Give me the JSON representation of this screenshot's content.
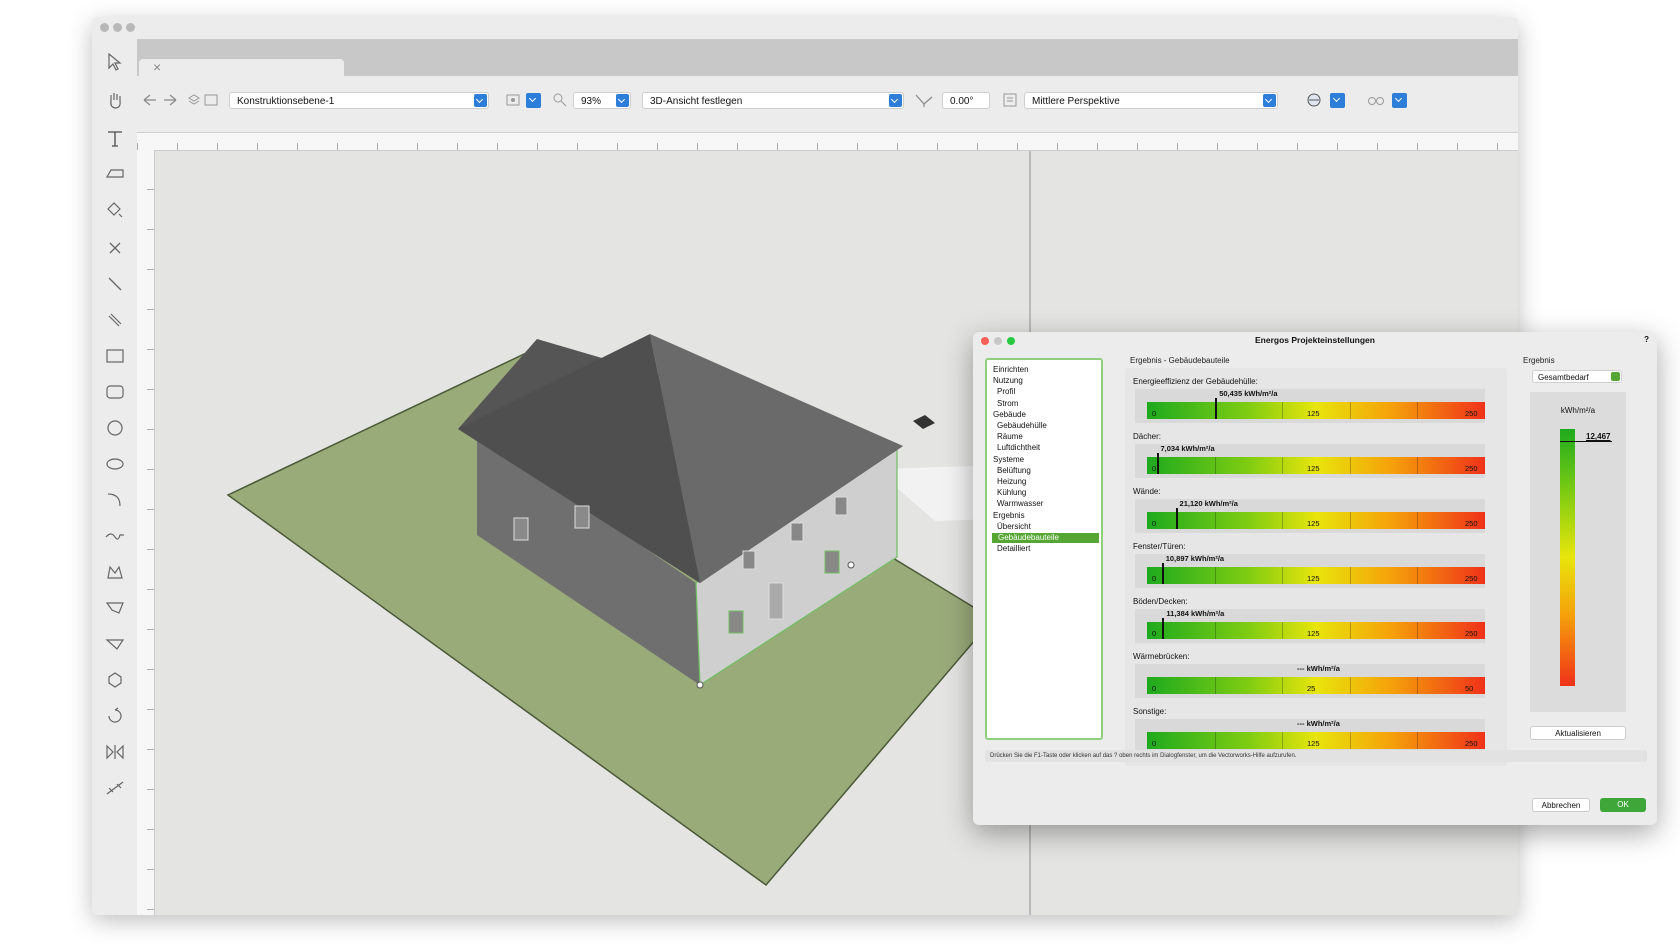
{
  "toolbar": {
    "layer_combo": "Konstruktionsebene-1",
    "zoom": "93%",
    "view_combo": "3D-Ansicht festlegen",
    "angle": "0.00°",
    "perspective_combo": "Mittlere Perspektive"
  },
  "dialog": {
    "title": "Energos Projekteinstellungen",
    "help": "?",
    "nav": [
      {
        "label": "Einrichten",
        "level": 0
      },
      {
        "label": "Nutzung",
        "level": 0
      },
      {
        "label": "Profil",
        "level": 1
      },
      {
        "label": "Strom",
        "level": 1
      },
      {
        "label": "Gebäude",
        "level": 0
      },
      {
        "label": "Gebäudehülle",
        "level": 1
      },
      {
        "label": "Räume",
        "level": 1
      },
      {
        "label": "Luftdichtheit",
        "level": 1
      },
      {
        "label": "Systeme",
        "level": 0
      },
      {
        "label": "Belüftung",
        "level": 1
      },
      {
        "label": "Heizung",
        "level": 1
      },
      {
        "label": "Kühlung",
        "level": 1
      },
      {
        "label": "Warmwasser",
        "level": 1
      },
      {
        "label": "Ergebnis",
        "level": 0
      },
      {
        "label": "Übersicht",
        "level": 1
      },
      {
        "label": "Gebäudebauteile",
        "level": 1,
        "selected": true
      },
      {
        "label": "Detailliert",
        "level": 1
      }
    ],
    "section_title": "Ergebnis - Gebäudebauteile",
    "bars": [
      {
        "label": "Energieeffizienz der Gebäudehülle:",
        "value_text": "50,435 kWh/m²/a",
        "value": 50.435,
        "max": 250,
        "tick_start": "0",
        "tick_mid": "125",
        "tick_end": "250"
      },
      {
        "label": "Dächer:",
        "value_text": "7,034 kWh/m²/a",
        "value": 7.034,
        "max": 250,
        "tick_start": "0",
        "tick_mid": "125",
        "tick_end": "250"
      },
      {
        "label": "Wände:",
        "value_text": "21,120 kWh/m²/a",
        "value": 21.12,
        "max": 250,
        "tick_start": "0",
        "tick_mid": "125",
        "tick_end": "250"
      },
      {
        "label": "Fenster/Türen:",
        "value_text": "10,897 kWh/m²/a",
        "value": 10.897,
        "max": 250,
        "tick_start": "0",
        "tick_mid": "125",
        "tick_end": "250"
      },
      {
        "label": "Böden/Decken:",
        "value_text": "11,384 kWh/m²/a",
        "value": 11.384,
        "max": 250,
        "tick_start": "0",
        "tick_mid": "125",
        "tick_end": "250"
      },
      {
        "label": "Wärmebrücken:",
        "value_text": "--- kWh/m²/a",
        "value": null,
        "max": 50,
        "tick_start": "0",
        "tick_mid": "25",
        "tick_end": "50"
      },
      {
        "label": "Sonstige:",
        "value_text": "--- kWh/m²/a",
        "value": null,
        "max": 250,
        "tick_start": "0",
        "tick_mid": "125",
        "tick_end": "250"
      }
    ],
    "result": {
      "title": "Ergebnis",
      "select_value": "Gesamtbedarf",
      "unit": "kWh/m²/a",
      "value_text": "12,467",
      "update_button": "Aktualisieren"
    },
    "hint": "Drücken Sie die F1-Taste oder klicken auf das ? oben rechts im Dialogfenster, um die Vectorworks-Hilfe aufzurufen.",
    "cancel_button": "Abbrechen",
    "ok_button": "OK"
  }
}
